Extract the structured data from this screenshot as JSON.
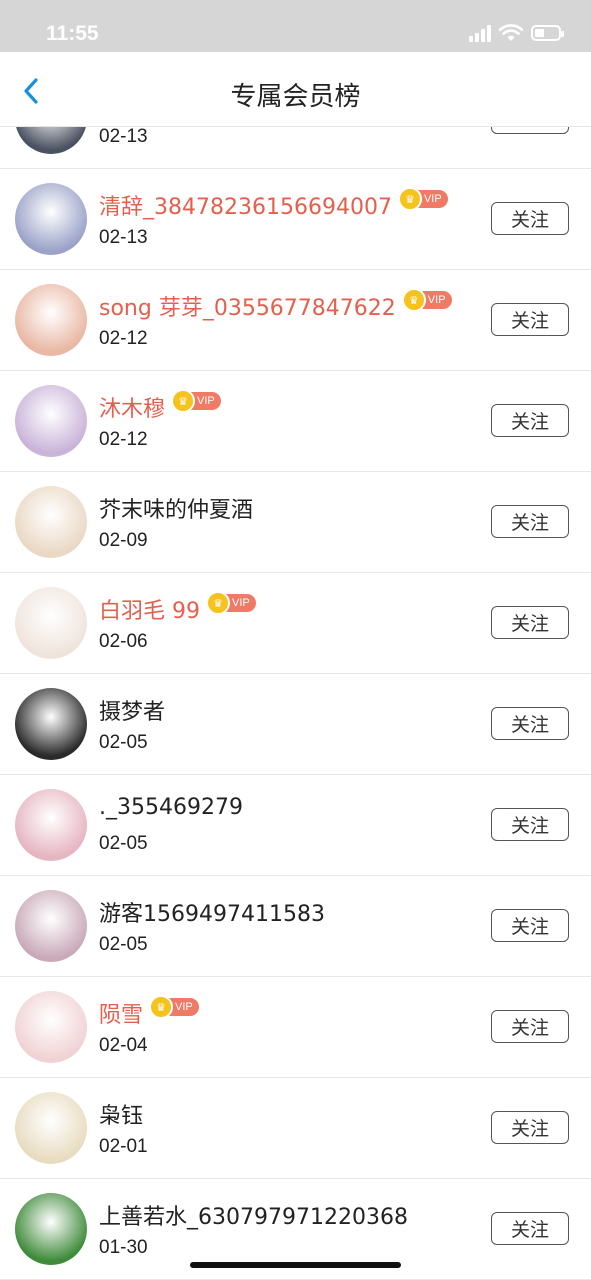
{
  "status_bar": {
    "time": "11:55"
  },
  "navbar": {
    "title": "专属会员榜"
  },
  "follow_label": "关注",
  "vip_label": "VIP",
  "users": [
    {
      "name": "",
      "date": "02-13",
      "vip": false,
      "avatar_color": "#4a5160"
    },
    {
      "name": "清辞_38478236156694007",
      "date": "02-13",
      "vip": true,
      "avatar_color": "#9aa2c8"
    },
    {
      "name": "song 芽芽_0355677847622",
      "date": "02-12",
      "vip": true,
      "avatar_color": "#e9b7a3"
    },
    {
      "name": "沐木穆",
      "date": "02-12",
      "vip": true,
      "avatar_color": "#c9b3d9"
    },
    {
      "name": "芥末味的仲夏酒",
      "date": "02-09",
      "vip": false,
      "avatar_color": "#ead8c4"
    },
    {
      "name": "白羽毛 99",
      "date": "02-06",
      "vip": true,
      "avatar_color": "#efe4dc"
    },
    {
      "name": "摄梦者",
      "date": "02-05",
      "vip": false,
      "avatar_color": "#2a2a2a"
    },
    {
      "name": "._355469279",
      "date": "02-05",
      "vip": false,
      "avatar_color": "#e6b5c2"
    },
    {
      "name": "游客1569497411583",
      "date": "02-05",
      "vip": false,
      "avatar_color": "#c9a9b8"
    },
    {
      "name": "陨雪",
      "date": "02-04",
      "vip": true,
      "avatar_color": "#f1d2d4"
    },
    {
      "name": "枭钰",
      "date": "02-01",
      "vip": false,
      "avatar_color": "#e8dcc0"
    },
    {
      "name": "上善若水_630797971220368",
      "date": "01-30",
      "vip": false,
      "avatar_color": "#3f8b3a"
    }
  ]
}
